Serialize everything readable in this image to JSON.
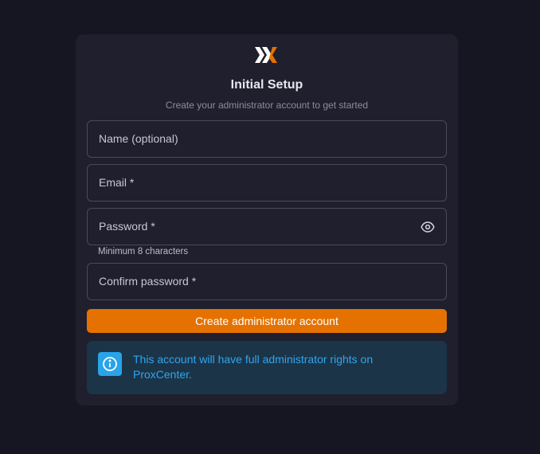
{
  "header": {
    "title": "Initial Setup",
    "subtitle": "Create your administrator account to get started"
  },
  "form": {
    "name_label": "Name (optional)",
    "email_label": "Email *",
    "password_label": "Password *",
    "password_helper": "Minimum 8 characters",
    "confirm_label": "Confirm password *",
    "submit_label": "Create administrator account"
  },
  "info": {
    "message": "This account will have full administrator rights on ProxCenter."
  },
  "icons": {
    "logo": "proxcenter-logo",
    "eye": "eye-icon",
    "info": "info-icon"
  },
  "colors": {
    "background": "#161622",
    "card": "#1f1f2d",
    "accent": "#e57200",
    "info_bg": "#1b3448",
    "info_text": "#2fa6ef"
  }
}
